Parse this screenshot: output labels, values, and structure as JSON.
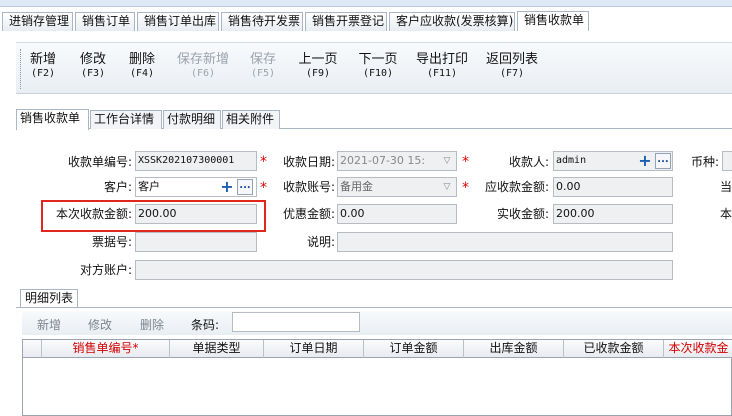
{
  "module_tabs": [
    "进销存管理",
    "销售订单",
    "销售订单出库",
    "销售待开发票",
    "销售开票登记",
    "客户应收款(发票核算)",
    "销售收款单"
  ],
  "toolbar": [
    {
      "label": "新增",
      "key": "(F2)",
      "enabled": true
    },
    {
      "label": "修改",
      "key": "(F3)",
      "enabled": true
    },
    {
      "label": "删除",
      "key": "(F4)",
      "enabled": true
    },
    {
      "label": "保存新增",
      "key": "(F6)",
      "enabled": false
    },
    {
      "label": "保存",
      "key": "(F5)",
      "enabled": false
    },
    {
      "label": "上一页",
      "key": "(F9)",
      "enabled": true
    },
    {
      "label": "下一页",
      "key": "(F10)",
      "enabled": true
    },
    {
      "label": "导出打印",
      "key": "(F11)",
      "enabled": true
    },
    {
      "label": "返回列表",
      "key": "(F7)",
      "enabled": true
    }
  ],
  "inner_tabs": [
    "销售收款单",
    "工作台详情",
    "付款明细",
    "相关附件"
  ],
  "form": {
    "receipt_no_label": "收款单编号:",
    "receipt_no": "XSSK202107300001",
    "date_label": "收款日期:",
    "date": "2021-07-30 15:",
    "payee_label": "收款人:",
    "payee": "admin",
    "currency_label": "币种:",
    "customer_label": "客户:",
    "customer": "客户",
    "account_label": "收款账号:",
    "account": "备用金",
    "receivable_label": "应收款金额:",
    "receivable": "0.00",
    "current_amount_label": "本次收款金额:",
    "current_amount": "200.00",
    "discount_label": "优惠金额:",
    "discount": "0.00",
    "actual_label": "实收金额:",
    "actual": "200.00",
    "bill_no_label": "票据号:",
    "bill_no": "",
    "note_label": "说明:",
    "note": "",
    "counter_account_label": "对方账户:",
    "counter_account": "",
    "right_cut_1": "当",
    "right_cut_2": "本",
    "required_mark": "*",
    "plus": "+",
    "ellipsis": "..."
  },
  "detail": {
    "tab": "明细列表",
    "buttons": [
      "新增",
      "修改",
      "删除"
    ],
    "barcode_label": "条码:",
    "barcode_value": "",
    "columns": [
      {
        "label": "销售单编号*",
        "red": true
      },
      {
        "label": "单据类型",
        "red": false
      },
      {
        "label": "订单日期",
        "red": false
      },
      {
        "label": "订单金额",
        "red": false
      },
      {
        "label": "出库金额",
        "red": false
      },
      {
        "label": "已收款金额",
        "red": false
      },
      {
        "label": "本次收款金",
        "red": true
      }
    ]
  }
}
